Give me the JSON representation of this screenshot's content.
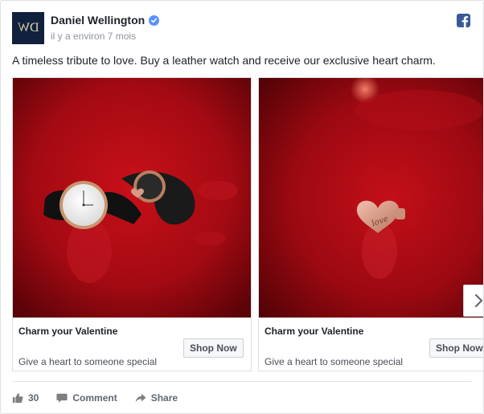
{
  "post": {
    "page_logo_text": "DW",
    "page_name": "Daniel Wellington",
    "timestamp": "il y a environ 7 mois",
    "text": "A timeless tribute to love. Buy a leather watch and receive our exclusive heart charm.",
    "platform_icon": "facebook-icon",
    "verified_icon": "verified-badge-icon"
  },
  "carousel": {
    "cards": [
      {
        "image_description": "watches-on-red-background",
        "title": "Charm your Valentine",
        "description": "Give a heart to someone special",
        "button": "Shop Now"
      },
      {
        "image_description": "heart-charm-on-red-background",
        "title": "Charm your Valentine",
        "description": "Give a heart to someone special",
        "button": "Shop Now"
      }
    ],
    "next_icon": "chevron-right-icon"
  },
  "actions": {
    "like_count": "30",
    "comment_label": "Comment",
    "share_label": "Share"
  },
  "colors": {
    "facebook_blue": "#3b5998",
    "verified_blue": "#5890ff",
    "logo_bg": "#11213d",
    "image_red": "#a30a12"
  }
}
